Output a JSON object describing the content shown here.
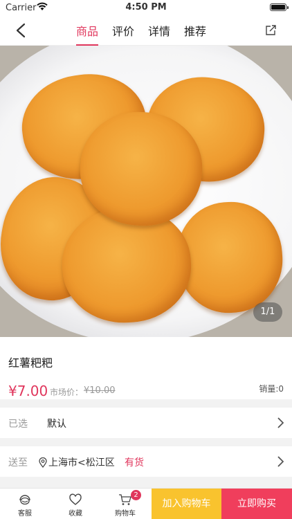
{
  "status": {
    "carrier": "Carrier",
    "time": "4:50 PM"
  },
  "nav": {
    "tabs": [
      "商品",
      "评价",
      "详情",
      "推荐"
    ],
    "active_tab": "商品"
  },
  "gallery": {
    "pager": "1/1"
  },
  "product": {
    "name": "红薯粑粑",
    "price": "¥7.00",
    "market_label": "市场价：",
    "market_price": "¥10.00",
    "sales": "销量:0"
  },
  "select_row": {
    "label": "已选",
    "value": "默认"
  },
  "ship_row": {
    "label": "送至",
    "location": "上海市<松江区",
    "stock": "有货"
  },
  "bottom_bar": {
    "service": "客服",
    "favorite": "收藏",
    "cart": "购物车",
    "cart_count": "2",
    "add_to_cart": "加入购物车",
    "buy_now": "立即购买"
  },
  "colors": {
    "accent": "#e0365c",
    "add_cart_bg": "#f9c32e",
    "buy_bg": "#f03e5c"
  }
}
